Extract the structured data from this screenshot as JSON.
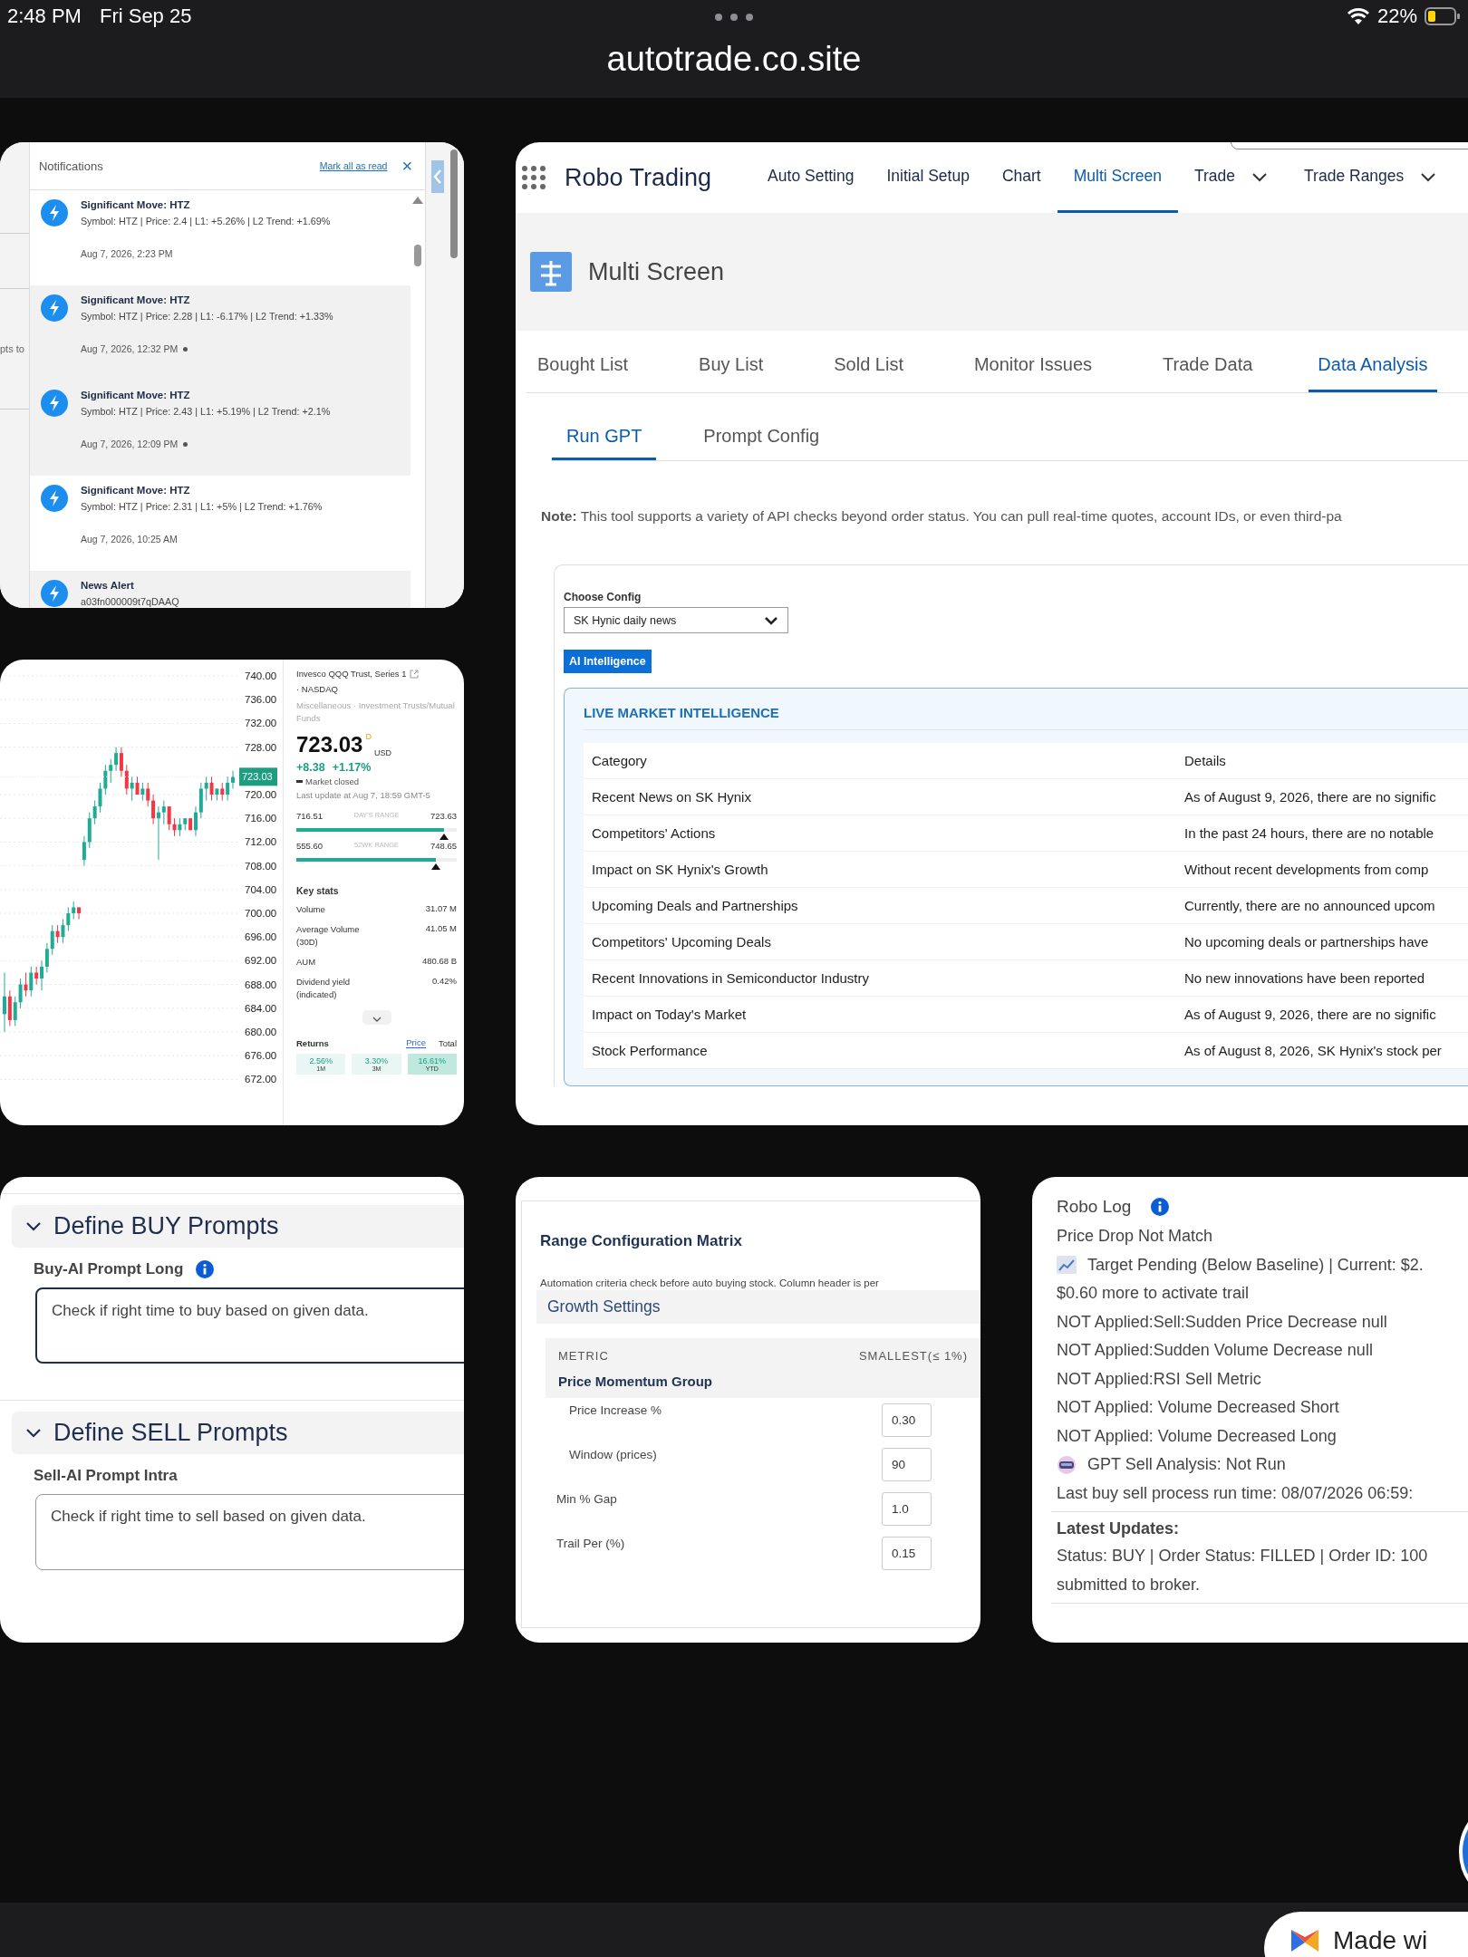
{
  "status_bar": {
    "time": "2:48 PM",
    "date": "Fri Sep 25",
    "battery": "22%"
  },
  "address_bar": {
    "url": "autotrade.co.site"
  },
  "notifications_window": {
    "behind_text": "pts to",
    "title": "Notifications",
    "mark_all": "Mark all as read",
    "close": "×",
    "items": [
      {
        "title": "Significant Move: HTZ",
        "body": "Symbol: HTZ | Price: 2.4 | L1: +5.26% | L2 Trend: +1.69%",
        "time": "Aug 7, 2026, 2:23 PM",
        "unread": false
      },
      {
        "title": "Significant Move: HTZ",
        "body": "Symbol: HTZ | Price: 2.28 | L1: -6.17% | L2 Trend: +1.33%",
        "time": "Aug 7, 2026, 12:32 PM",
        "unread": true
      },
      {
        "title": "Significant Move: HTZ",
        "body": "Symbol: HTZ | Price: 2.43 | L1: +5.19% | L2 Trend: +2.1%",
        "time": "Aug 7, 2026, 12:09 PM",
        "unread": true
      },
      {
        "title": "Significant Move: HTZ",
        "body": "Symbol: HTZ | Price: 2.31 | L1: +5% | L2 Trend: +1.76%",
        "time": "Aug 7, 2026, 10:25 AM",
        "unread": false
      },
      {
        "title": "News Alert",
        "body": "a03fn000009t7qDAAQ",
        "unread": true
      }
    ]
  },
  "chart_window": {
    "chart_data": {
      "type": "candlestick",
      "ylim": [
        672,
        740
      ],
      "grid": true,
      "yticks": [
        {
          "value": 740,
          "label": "740.00"
        },
        {
          "value": 736,
          "label": "736.00"
        },
        {
          "value": 732,
          "label": "732.00"
        },
        {
          "value": 728,
          "label": "728.00"
        },
        {
          "value": 720,
          "label": "720.00"
        },
        {
          "value": 716,
          "label": "716.00"
        },
        {
          "value": 712,
          "label": "712.00"
        },
        {
          "value": 708,
          "label": "708.00"
        },
        {
          "value": 704,
          "label": "704.00"
        },
        {
          "value": 700,
          "label": "700.00"
        },
        {
          "value": 696,
          "label": "696.00"
        },
        {
          "value": 692,
          "label": "692.00"
        },
        {
          "value": 688,
          "label": "688.00"
        },
        {
          "value": 684,
          "label": "684.00"
        },
        {
          "value": 680,
          "label": "680.00"
        },
        {
          "value": 676,
          "label": "676.00"
        },
        {
          "value": 672,
          "label": "672.00"
        }
      ],
      "ohlc": [
        [
          683,
          690,
          680,
          686
        ],
        [
          686,
          687,
          681,
          682
        ],
        [
          682,
          686,
          681,
          685
        ],
        [
          685,
          689,
          684,
          688
        ],
        [
          688,
          690,
          686,
          687
        ],
        [
          687,
          691,
          686,
          690
        ],
        [
          690,
          691,
          688,
          689
        ],
        [
          689,
          692,
          687,
          691
        ],
        [
          691,
          695,
          690,
          694
        ],
        [
          694,
          698,
          693,
          697
        ],
        [
          697,
          698,
          695,
          696
        ],
        [
          696,
          699,
          695,
          698
        ],
        [
          698,
          701,
          697,
          700
        ],
        [
          700,
          702,
          699,
          701
        ],
        [
          701,
          701,
          699,
          700
        ],
        [
          709,
          713,
          708,
          712
        ],
        [
          712,
          717,
          711,
          716
        ],
        [
          716,
          719,
          715,
          718
        ],
        [
          718,
          722,
          717,
          721
        ],
        [
          721,
          725,
          720,
          724
        ],
        [
          724,
          726,
          722,
          725
        ],
        [
          725,
          728,
          724,
          727
        ],
        [
          727,
          728,
          723,
          724
        ],
        [
          724,
          725,
          720,
          721
        ],
        [
          721,
          723,
          719,
          722
        ],
        [
          722,
          723,
          720,
          720
        ],
        [
          720,
          722,
          719,
          721
        ],
        [
          721,
          722,
          718,
          719
        ],
        [
          719,
          720,
          715,
          716
        ],
        [
          716,
          718,
          709,
          717
        ],
        [
          717,
          719,
          715,
          718
        ],
        [
          718,
          718,
          714,
          715
        ],
        [
          715,
          716,
          713,
          714
        ],
        [
          714,
          716,
          713,
          715
        ],
        [
          715,
          716,
          714,
          716
        ],
        [
          716,
          716,
          714,
          714
        ],
        [
          714,
          718,
          713,
          717
        ],
        [
          717,
          722,
          716,
          721
        ],
        [
          721,
          723,
          719,
          722
        ],
        [
          722,
          723,
          719,
          720
        ],
        [
          720,
          721,
          719,
          721
        ],
        [
          721,
          722,
          719,
          720
        ],
        [
          720,
          723,
          719,
          722
        ],
        [
          722,
          724,
          721,
          723
        ]
      ]
    },
    "price_tag": "723.03",
    "quote": {
      "name": "Invesco QQQ Trust, Series 1",
      "exchange": "· NASDAQ",
      "category": "Miscellaneous · Investment Trusts/Mutual Funds",
      "price": "723.03",
      "flag": "D",
      "currency": "USD",
      "change": "+8.38",
      "change_pct": "+1.17%",
      "market_state": "Market closed",
      "last_update": "Last update at Aug 7, 18:59 GMT-5",
      "ranges": [
        {
          "low": "716.51",
          "label": "DAY'S RANGE",
          "high": "723.63",
          "level": 0.92
        },
        {
          "low": "555.60",
          "label": "52WK RANGE",
          "high": "748.65",
          "level": 0.87
        }
      ],
      "key_stats_title": "Key stats",
      "stats": [
        {
          "label": "Volume",
          "value": "31.07 M"
        },
        {
          "label": "Average Volume (30D)",
          "value": "41.05 M"
        },
        {
          "label": "AUM",
          "value": "480.68 B"
        },
        {
          "label": "Dividend yield (indicated)",
          "value": "0.42%"
        }
      ],
      "returns_title": "Returns",
      "return_modes": [
        {
          "label": "Price",
          "selected": true
        },
        {
          "label": "Total",
          "selected": false
        }
      ],
      "returns": [
        {
          "value": "2.56%",
          "period": "1M",
          "selected": false
        },
        {
          "value": "3.30%",
          "period": "3M",
          "selected": false
        },
        {
          "value": "16.61%",
          "period": "YTD",
          "selected": true
        }
      ]
    }
  },
  "main_window": {
    "app_name": "Robo Trading",
    "nav": [
      {
        "label": "Auto Setting",
        "selected": false,
        "dropdown": false
      },
      {
        "label": "Initial Setup",
        "selected": false,
        "dropdown": false
      },
      {
        "label": "Chart",
        "selected": false,
        "dropdown": false
      },
      {
        "label": "Multi Screen",
        "selected": true,
        "dropdown": false
      },
      {
        "label": "Trade",
        "selected": false,
        "dropdown": true
      },
      {
        "label": "Trade Ranges",
        "selected": false,
        "dropdown": true
      }
    ],
    "page_title": "Multi Screen",
    "tabs": [
      {
        "label": "Bought List",
        "selected": false
      },
      {
        "label": "Buy List",
        "selected": false
      },
      {
        "label": "Sold List",
        "selected": false
      },
      {
        "label": "Monitor Issues",
        "selected": false
      },
      {
        "label": "Trade Data",
        "selected": false
      },
      {
        "label": "Data Analysis",
        "selected": true
      }
    ],
    "subtabs": [
      {
        "label": "Run GPT",
        "selected": true
      },
      {
        "label": "Prompt Config",
        "selected": false
      }
    ],
    "note": "**Note:** This tool supports a variety of API checks beyond order status. You can pull real-time quotes, account IDs, or even third-pa",
    "config_label": "Choose Config",
    "config_value": "SK Hynic daily news",
    "run_button": "AI Intelligence",
    "intel_title": "LIVE MARKET INTELLIGENCE",
    "columns": [
      "Category",
      "Details"
    ],
    "rows": [
      [
        "Recent News on SK Hynix",
        "As of August 9, 2026, there are no signific"
      ],
      [
        "Competitors' Actions",
        "In the past 24 hours, there are no notable"
      ],
      [
        "Impact on SK Hynix's Growth",
        "Without recent developments from comp"
      ],
      [
        "Upcoming Deals and Partnerships",
        "Currently, there are no announced upcom"
      ],
      [
        "Competitors' Upcoming Deals",
        "No upcoming deals or partnerships have"
      ],
      [
        "Recent Innovations in Semiconductor Industry",
        "No new innovations have been reported"
      ],
      [
        "Impact on Today's Market",
        "As of August 9, 2026, there are no signific"
      ],
      [
        "Stock Performance",
        "As of August 8, 2026, SK Hynix's stock per"
      ]
    ]
  },
  "prompts_window": {
    "sections": [
      {
        "title": "Define BUY Prompts",
        "expanded": true,
        "field_label": "Buy-AI Prompt Long",
        "info": true,
        "value": "Check if right time to buy based on given data.",
        "focused": true
      },
      {
        "title": "Define SELL Prompts",
        "expanded": true,
        "field_label": "Sell-AI Prompt Intra",
        "info": false,
        "value": "Check if right time to sell based on given data.",
        "focused": false
      }
    ]
  },
  "matrix_window": {
    "title": "Range Configuration Matrix",
    "description": "Automation criteria check before auto buying stock. Column header is per",
    "section": "Growth Settings",
    "columns": [
      "METRIC",
      "SMALLEST(≤ 1%)"
    ],
    "rows": [
      {
        "kind": "group",
        "label": "Price Momentum Group",
        "children": [
          {
            "kind": "row",
            "label": "Price Increase %",
            "value": "0.30"
          },
          {
            "kind": "row",
            "label": "Window (prices)",
            "value": "90"
          }
        ]
      },
      {
        "kind": "row",
        "label": "Min % Gap",
        "value": "1.0"
      },
      {
        "kind": "row",
        "label": "Trail Per (%)",
        "value": "0.15"
      }
    ]
  },
  "log_window": {
    "title": "Robo Log",
    "lines": [
      {
        "kind": "text",
        "text": "Price Drop Not Match"
      },
      {
        "kind": "chart",
        "text": "Target Pending (Below Baseline) | Current: $2."
      },
      {
        "kind": "text",
        "text": "$0.60 more to activate trail"
      },
      {
        "kind": "text",
        "text": "NOT Applied:Sell:Sudden Price Decrease null"
      },
      {
        "kind": "text",
        "text": "NOT Applied:Sudden Volume Decrease null"
      },
      {
        "kind": "text",
        "text": "NOT Applied:RSI Sell Metric"
      },
      {
        "kind": "text",
        "text": "NOT Applied: Volume Decreased Short"
      },
      {
        "kind": "text",
        "text": "NOT Applied: Volume Decreased Long"
      },
      {
        "kind": "robot",
        "text": "GPT Sell Analysis: Not Run"
      },
      {
        "kind": "text",
        "text": "Last buy sell process run time: 08/07/2026 06:59:"
      }
    ],
    "updates_title": "Latest Updates:",
    "updates": [
      "Status: BUY | Order Status: FILLED | Order ID: 100",
      "submitted to broker."
    ]
  },
  "made_with_badge": {
    "label": "Made wi"
  }
}
